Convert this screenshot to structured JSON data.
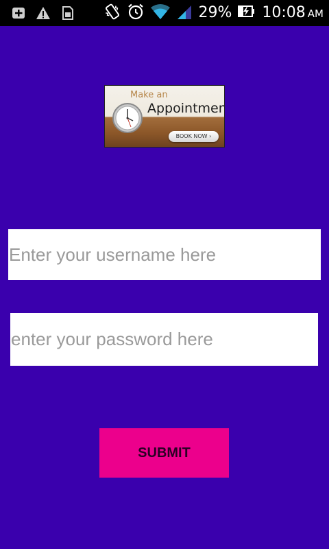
{
  "status_bar": {
    "icons_left": [
      "add-notification-icon",
      "warning-icon",
      "sim-card-icon"
    ],
    "icons_right": [
      "vibrate-icon",
      "alarm-icon",
      "wifi-icon",
      "signal-icon",
      "battery-charging-icon"
    ],
    "battery_percent": "29%",
    "time": "10:08",
    "ampm": "AM"
  },
  "banner": {
    "line1": "Make an",
    "line2": "Appointment",
    "cta": "BOOK NOW ›"
  },
  "form": {
    "username_placeholder": "Enter your username here",
    "username_value": "",
    "password_placeholder": "enter your password here",
    "password_value": "",
    "submit_label": "SUBMIT"
  },
  "colors": {
    "background": "#3a00ad",
    "status_bar": "#000000",
    "submit_button": "#ec008c",
    "input_background": "#ffffff"
  }
}
